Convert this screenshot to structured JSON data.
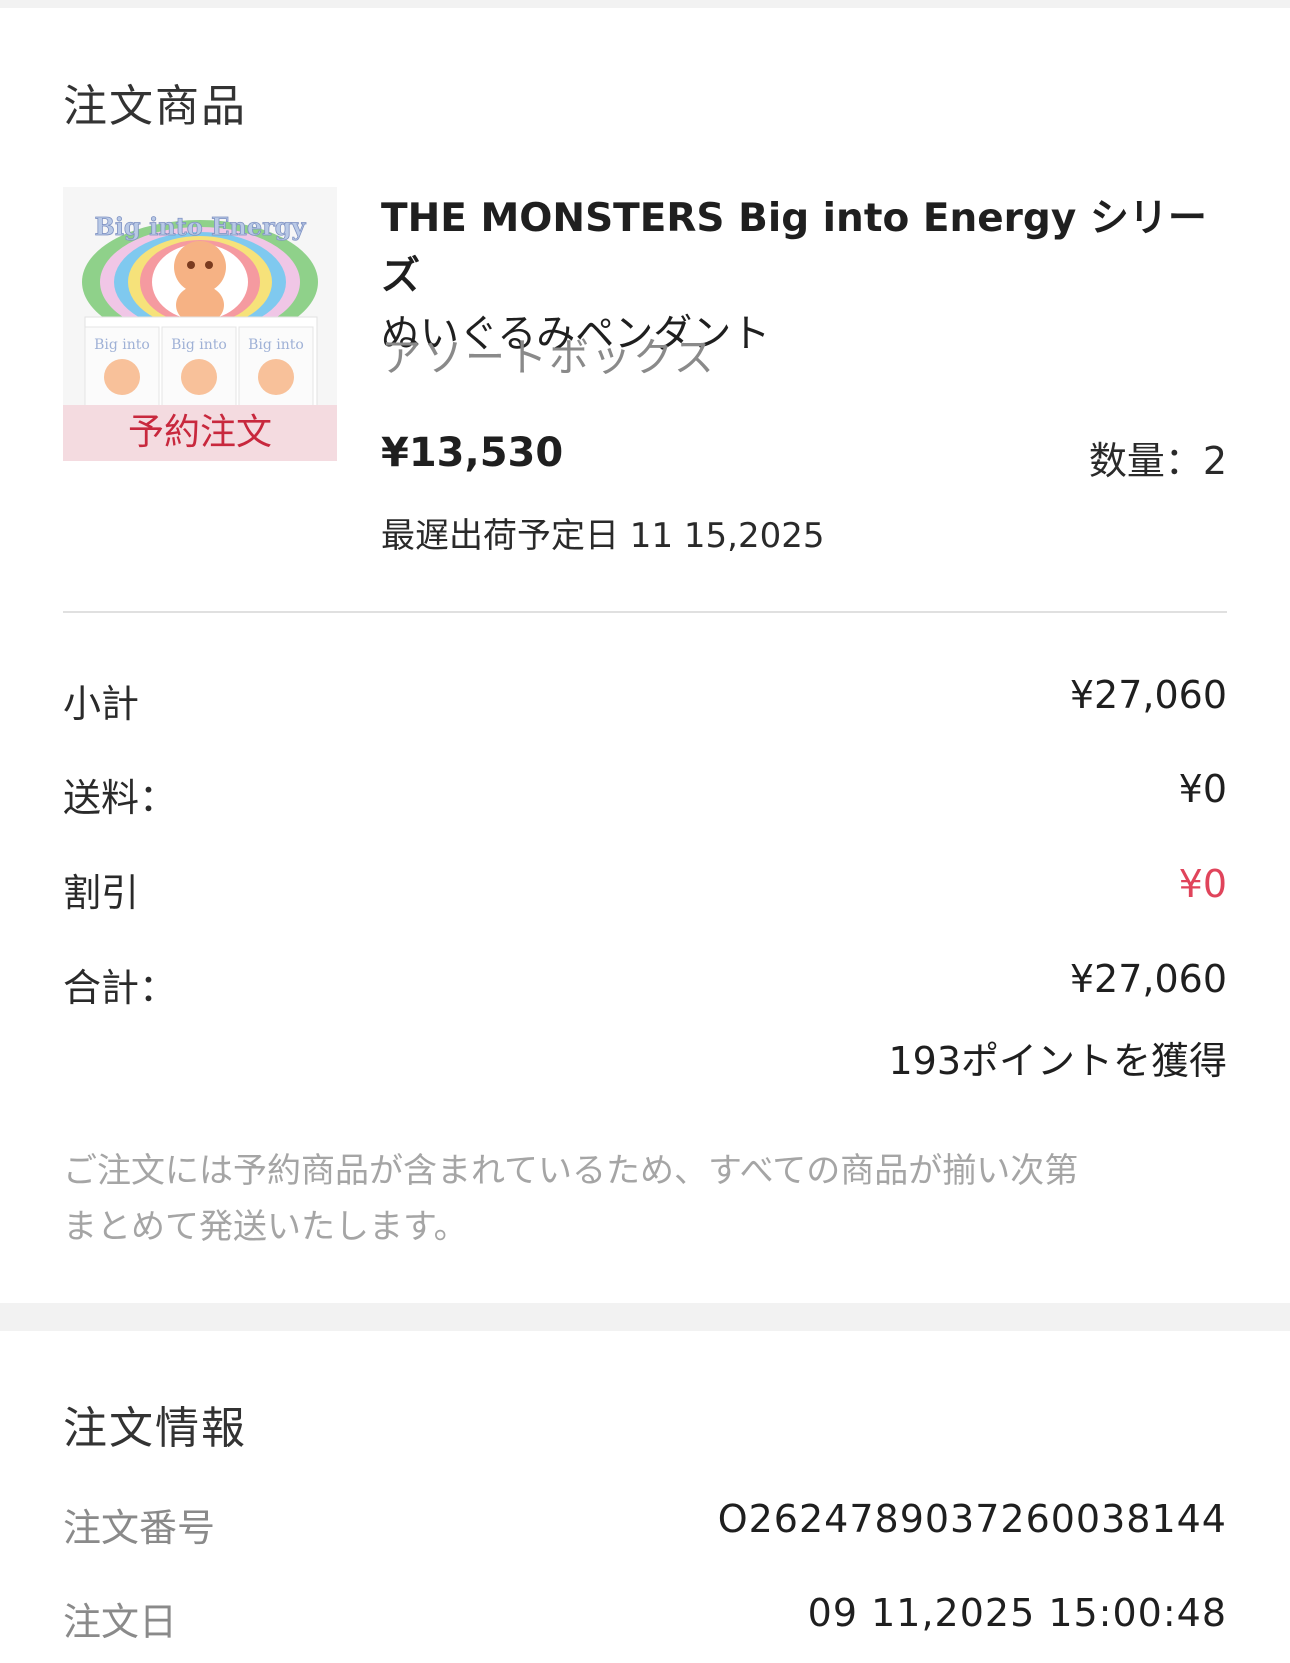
{
  "order_items": {
    "section_title": "注文商品",
    "item": {
      "badge": "予約注文",
      "name_line1": "THE MONSTERS Big into Energy シリーズ",
      "name_line2": "ぬいぐるみペンダント",
      "variant": "アソートボックス",
      "price": "¥13,530",
      "quantity": "数量：2",
      "ship_date": "最遅出荷予定日 11 15,2025",
      "image_text": "Big into Energy"
    }
  },
  "summary": {
    "subtotal_label": "小計",
    "subtotal_value": "¥27,060",
    "shipping_label": "送料：",
    "shipping_value": "¥0",
    "discount_label": "割引",
    "discount_value": "¥0",
    "total_label": "合計：",
    "total_value": "¥27,060",
    "points": "193ポイントを獲得",
    "note_line1": "ご注文には予約商品が含まれているため、すべての商品が揃い次第",
    "note_line2": "まとめて発送いたします。"
  },
  "order_info": {
    "section_title": "注文情報",
    "order_number_label": "注文番号",
    "order_number_value": "O262478903726003814​4",
    "order_date_label": "注文日",
    "order_date_value": "09 11,2025 15:00:48"
  },
  "colors": {
    "discount_red": "#e0445b",
    "badge_bg": "#f4dbe0",
    "badge_text": "#c8283d"
  }
}
